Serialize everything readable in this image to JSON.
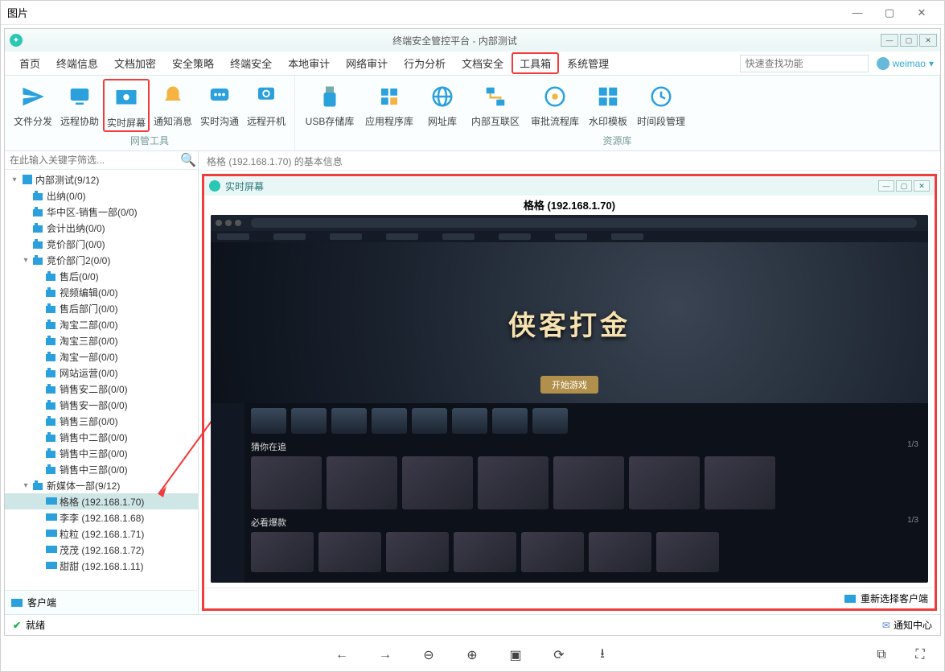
{
  "outer_title": "图片",
  "app_title": "终端安全管控平台 - 内部测试",
  "menus": [
    "首页",
    "终端信息",
    "文档加密",
    "安全策略",
    "终端安全",
    "本地审计",
    "网络审计",
    "行为分析",
    "文档安全",
    "工具箱",
    "系统管理"
  ],
  "menu_highlight_index": 9,
  "search_placeholder": "快速查找功能",
  "user_name": "weimao",
  "ribbon_group1_label": "网管工具",
  "ribbon_group2_label": "资源库",
  "ribbon1": [
    "文件分发",
    "远程协助",
    "实时屏幕",
    "通知消息",
    "实时沟通",
    "远程开机"
  ],
  "ribbon1_highlight_index": 2,
  "ribbon2": [
    "USB存储库",
    "应用程序库",
    "网址库",
    "内部互联区",
    "审批流程库",
    "水印模板",
    "时间段管理"
  ],
  "sidebar_search_placeholder": "在此输入关键字筛选...",
  "tree": {
    "root": "内部测试(9/12)",
    "n1": "出纳(0/0)",
    "n2": "华中区-销售一部(0/0)",
    "n3": "会计出纳(0/0)",
    "n4": "竞价部门(0/0)",
    "n5": "竞价部门2(0/0)",
    "n5_1": "售后(0/0)",
    "n5_2": "视频编辑(0/0)",
    "n5_3": "售后部门(0/0)",
    "n5_4": "淘宝二部(0/0)",
    "n5_5": "淘宝三部(0/0)",
    "n5_6": "淘宝一部(0/0)",
    "n5_7": "网站运营(0/0)",
    "n5_8": "销售安二部(0/0)",
    "n5_9": "销售安一部(0/0)",
    "n5_10": "销售三部(0/0)",
    "n5_11": "销售中二部(0/0)",
    "n5_12": "销售中三部(0/0)",
    "n5_13": "销售中三部(0/0)",
    "n6": "新媒体一部(9/12)",
    "c1": "格格 (192.168.1.70)",
    "c2": "李李 (192.168.1.68)",
    "c3": "粒粒 (192.168.1.71)",
    "c4": "茂茂 (192.168.1.72)",
    "c5": "甜甜 (192.168.1.11)"
  },
  "sidebar_bottom": "客户端",
  "info_bar": "格格 (192.168.1.70) 的基本信息",
  "screen_title": "实时屏幕",
  "screen_sub": "格格 (192.168.1.70)",
  "hero_title": "侠客打金",
  "hero_btn": "开始游戏",
  "bm_section1": "猜你在追",
  "bm_section2": "必看爆款",
  "bm_page": "1/3",
  "screen_footer": "重新选择客户端",
  "status_ready": "就绪",
  "status_notice": "通知中心"
}
